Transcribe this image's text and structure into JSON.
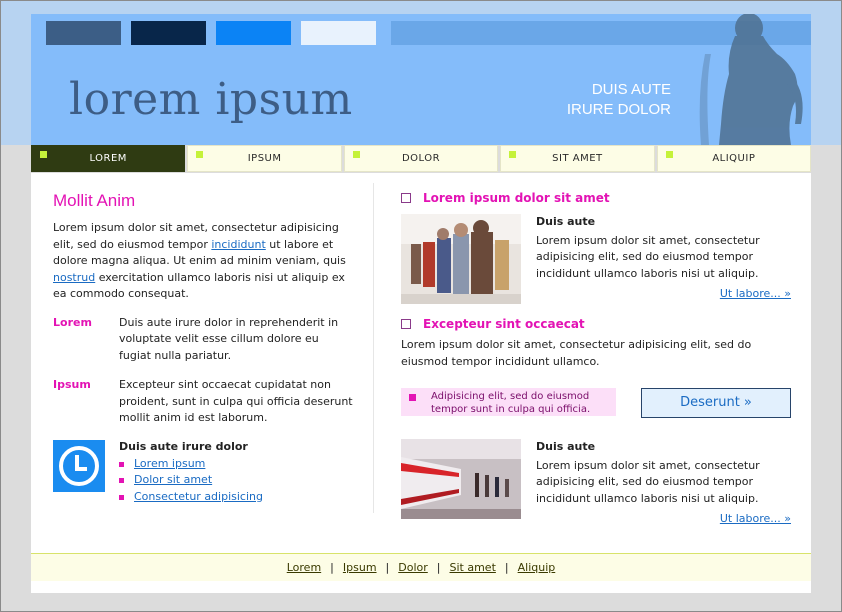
{
  "colors": {
    "accent": "#e313b4",
    "header_bg": "#84bcfa",
    "logo": "#3d5d85",
    "nav_active": "#2f3b12",
    "nav_marker": "#c5f23a",
    "link": "#1a6bc3"
  },
  "header": {
    "swatches": [
      "#3c5e86",
      "#08264a",
      "#0b83f5",
      "#e8f2fd"
    ],
    "logo": "lorem ipsum",
    "tagline_1": "DUIS AUTE",
    "tagline_2": "IRURE DOLOR",
    "image_icon": "woman-silhouette-icon"
  },
  "nav": {
    "items": [
      {
        "label": "LOREM"
      },
      {
        "label": "IPSUM"
      },
      {
        "label": "DOLOR"
      },
      {
        "label": "SIT AMET"
      },
      {
        "label": "ALIQUIP"
      }
    ]
  },
  "left": {
    "heading": "Mollit Anim",
    "intro_1": "Lorem ipsum dolor sit amet, consectetur adipisicing elit, sed do eiusmod tempor ",
    "intro_link_1": "incididunt",
    "intro_2": " ut labore et dolore magna aliqua. Ut enim ad minim veniam, quis ",
    "intro_link_2": "nostrud",
    "intro_3": " exercitation ullamco laboris nisi ut aliquip ex ea commodo consequat.",
    "defs": [
      {
        "term": "Lorem",
        "desc": "Duis aute irure dolor in reprehenderit in voluptate velit esse cillum dolore eu fugiat nulla pariatur."
      },
      {
        "term": "Ipsum",
        "desc": "Excepteur sint occaecat cupidatat non proident, sunt in culpa qui officia deserunt mollit anim id est laborum."
      }
    ],
    "clock": {
      "icon": "clock-icon",
      "title": "Duis aute irure dolor",
      "links": [
        "Lorem ipsum",
        "Dolor sit amet",
        "Consectetur adipisicing"
      ]
    }
  },
  "right": {
    "section1": {
      "title": "Lorem ipsum dolor sit amet",
      "sub": "Duis aute",
      "body": "Lorem ipsum dolor sit amet, consectetur adipisicing elit, sed do eiusmod tempor incididunt ullamco laboris nisi ut aliquip.",
      "more": "Ut labore... »",
      "image": "crowd-photo"
    },
    "section2": {
      "title": "Excepteur sint occaecat",
      "body": "Lorem ipsum dolor sit amet, consectetur adipisicing elit, sed do eiusmod tempor incididunt ullamco.",
      "highlight": "Adipisicing elit, sed do eiusmod tempor sunt in culpa qui officia.",
      "cta": "Deserunt »"
    },
    "section3": {
      "sub": "Duis aute",
      "body": "Lorem ipsum dolor sit amet, consectetur adipisicing elit, sed do eiusmod tempor incididunt ullamco laboris nisi ut aliquip.",
      "more": "Ut labore... »",
      "image": "train-photo"
    }
  },
  "footer": {
    "links": [
      "Lorem",
      "Ipsum",
      "Dolor",
      "Sit amet",
      "Aliquip"
    ]
  }
}
